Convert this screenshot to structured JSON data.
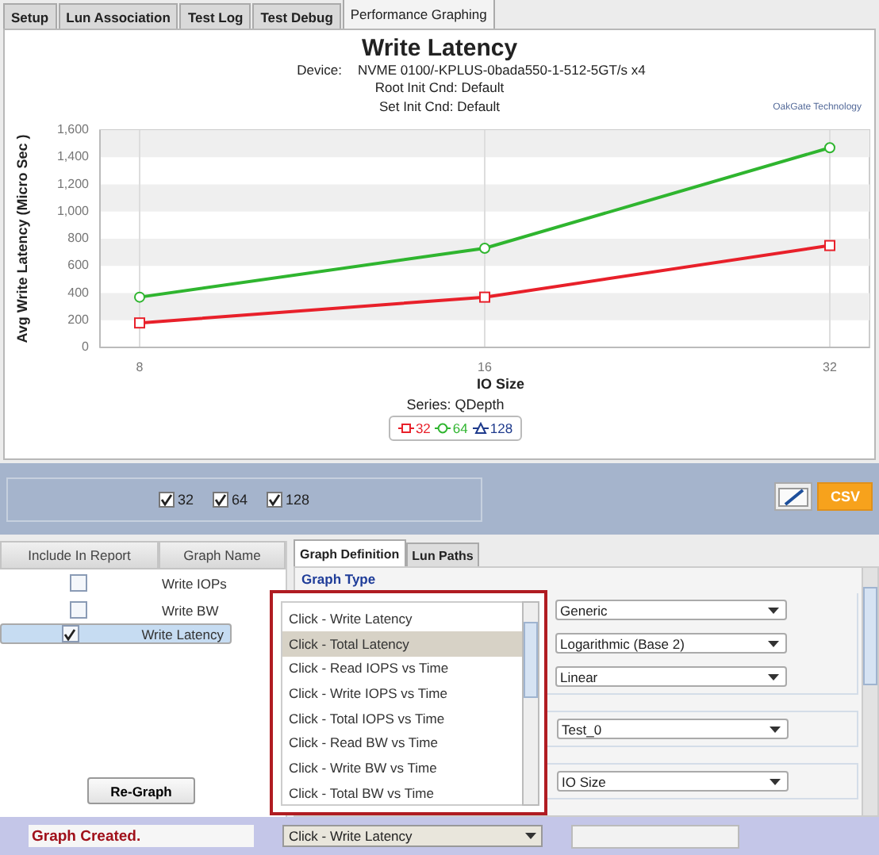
{
  "tabs": [
    {
      "label": "Setup",
      "selected": false
    },
    {
      "label": "Lun Association",
      "selected": false
    },
    {
      "label": "Test Log",
      "selected": false
    },
    {
      "label": "Test Debug",
      "selected": false
    },
    {
      "label": "Performance Graphing",
      "selected": true
    }
  ],
  "graph": {
    "title": "Write Latency",
    "device_label": "Device:",
    "device": "NVME 0100/-KPLUS-0bada550-1-512-5GT/s x4",
    "root_init": "Root Init Cnd: Default",
    "set_init": "Set Init Cnd: Default",
    "vendor": "OakGate Technology",
    "chart_data": {
      "type": "line",
      "grid": true,
      "xlabel": "IO Size",
      "ylabel": "Avg Write Latency (Micro Sec )",
      "categories": [
        "8",
        "16",
        "32"
      ],
      "ylim": [
        0,
        1600
      ],
      "yticks": [
        0,
        {
          "value": 200,
          "label": "200"
        },
        {
          "value": 400,
          "label": "400"
        },
        {
          "value": 600,
          "label": "600"
        },
        {
          "value": 800,
          "label": "800"
        },
        {
          "value": 1000,
          "label": "1,000"
        },
        {
          "value": 1200,
          "label": "1,200"
        },
        {
          "value": 1400,
          "label": "1,400"
        },
        {
          "value": 1600,
          "label": "1,600"
        }
      ],
      "series": [
        {
          "name": "32",
          "color": "#e8202a",
          "marker": "square",
          "values": [
            180,
            370,
            750
          ]
        },
        {
          "name": "64",
          "color": "#2fb52f",
          "marker": "circle",
          "values": [
            370,
            730,
            1470
          ]
        },
        {
          "name": "128",
          "color": "#1e3a8c",
          "marker": "triangle",
          "values": [
            null,
            null,
            null
          ]
        }
      ]
    },
    "legend_title": "Series: QDepth"
  },
  "series_filter": [
    {
      "label": "32",
      "checked": true
    },
    {
      "label": "64",
      "checked": true
    },
    {
      "label": "128",
      "checked": true
    }
  ],
  "csv_button": "CSV",
  "report_table": {
    "columns": [
      "Include In Report",
      "Graph Name"
    ],
    "rows": [
      {
        "include": false,
        "name": "Write IOPs",
        "selected": false
      },
      {
        "include": false,
        "name": "Write BW",
        "selected": false
      },
      {
        "include": true,
        "name": "Write Latency",
        "selected": true
      }
    ]
  },
  "regraph_button": "Re-Graph",
  "panel_tabs": [
    {
      "label": "Graph Definition",
      "selected": true
    },
    {
      "label": "Lun Paths",
      "selected": false
    }
  ],
  "graph_type_label": "Graph Type",
  "graph_type_options": [
    {
      "label": "Click - Write Latency",
      "selected": false
    },
    {
      "label": "Click - Total Latency",
      "selected": true
    },
    {
      "label": "Click - Read IOPS vs Time",
      "selected": false
    },
    {
      "label": "Click - Write IOPS vs Time",
      "selected": false
    },
    {
      "label": "Click - Total IOPS vs Time",
      "selected": false
    },
    {
      "label": "Click - Read BW vs Time",
      "selected": false
    },
    {
      "label": "Click - Write BW vs Time",
      "selected": false
    },
    {
      "label": "Click - Total BW vs Time",
      "selected": false
    }
  ],
  "graph_type_value": "Click - Write Latency",
  "select_groups": [
    {
      "selects": [
        "Generic",
        "Logarithmic (Base 2)",
        "Linear"
      ]
    },
    {
      "selects": [
        "Test_0"
      ]
    },
    {
      "selects": [
        "IO Size"
      ]
    }
  ],
  "status": "Graph Created."
}
